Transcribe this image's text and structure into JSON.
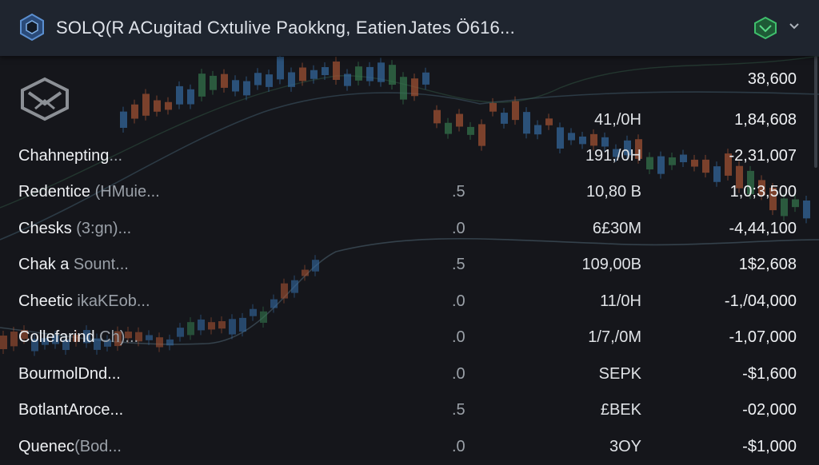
{
  "header": {
    "title": "SOLQ(R ACugitad Cxtulive Paokkng, Eatien Jates  Ö616...",
    "logo_icon": "hexagon-logo-icon",
    "status_icon": "green-hexagon-icon",
    "dropdown_icon": "chevron-down-icon"
  },
  "panel": {
    "icon": "hexagon-emblem-icon"
  },
  "top_values": [
    {
      "volume": "",
      "value": "38,600"
    },
    {
      "volume": "41,/0H",
      "value": "1,84,608"
    }
  ],
  "rows": [
    {
      "name": "Chahnepting",
      "name_suffix": "...",
      "mid": "",
      "volume": "191,/0H",
      "value": "-2,31,007"
    },
    {
      "name": "Redentice",
      "name_suffix": " (HMuie...",
      "mid": ".5",
      "volume": "10,80 B",
      "value": "1,0;3,500"
    },
    {
      "name": "Chesks",
      "name_suffix": " (3:gn)...",
      "mid": ".0",
      "volume": "6£30M",
      "value": "-4,44,100"
    },
    {
      "name": "Chak a",
      "name_suffix": " Sount...",
      "mid": ".5",
      "volume": "109,00B",
      "value": "1$2,608"
    },
    {
      "name": "Cheetic",
      "name_suffix": " ikaKEob...",
      "mid": ".0",
      "volume": "11/0H",
      "value": "-1,/04,000"
    },
    {
      "name": "Collefarind",
      "name_suffix": " Ch)...",
      "mid": ".0",
      "volume": "1/7,/0M",
      "value": "-1,07,000"
    },
    {
      "name": "BourmolDnd...",
      "name_suffix": "",
      "mid": ".0",
      "volume": "SEPK",
      "value": "-$1,600"
    },
    {
      "name": "BotlantAroce...",
      "name_suffix": "",
      "mid": ".5",
      "volume": "£BEK",
      "value": "-02,000"
    },
    {
      "name": "Quenec",
      "name_suffix": "(Bod...",
      "mid": ".0",
      "volume": "3OY",
      "value": "-$1,000"
    }
  ],
  "colors": {
    "background": "#16181d",
    "header": "#1f252f",
    "candle_up": "#3d7fc0",
    "candle_down": "#c8623a",
    "candle_green": "#3d8f5a",
    "accent_green": "#2f9a56"
  }
}
